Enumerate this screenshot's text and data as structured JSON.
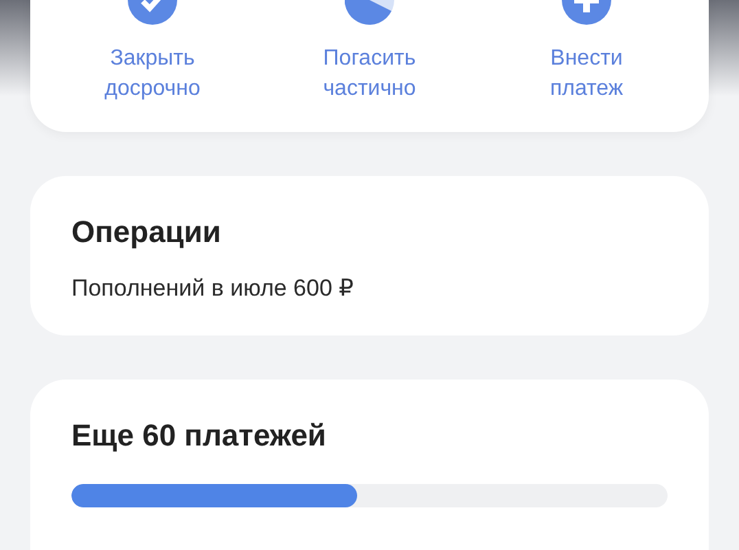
{
  "actions": [
    {
      "kind": "close",
      "label": "Закрыть досрочно"
    },
    {
      "kind": "partial",
      "label": "Погасить частично"
    },
    {
      "kind": "pay",
      "label": "Внести платеж"
    }
  ],
  "operations": {
    "title": "Операции",
    "subtitle": "Пополнений в июле 600 ₽"
  },
  "payments": {
    "title": "Еще 60 платежей",
    "level": 0.48
  }
}
